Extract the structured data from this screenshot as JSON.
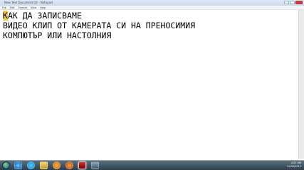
{
  "window": {
    "title": "New Text Document.txt - Notepad",
    "controls": [
      "minimize",
      "maximize",
      "close"
    ]
  },
  "menu": {
    "items": [
      "File",
      "Edit",
      "Format",
      "View",
      "Help"
    ]
  },
  "document": {
    "highlight_char": "К",
    "line1_rest": "АК ДА ЗАПИСВАМЕ",
    "line2": "ВИДЕО КЛИП ОТ КАМЕРАТА СИ НА ПРЕНОСИМИЯ",
    "line3": "КОМПЮТЪР ИЛИ НАСТОЛНИЯ"
  },
  "taskbar": {
    "icons": [
      "start-orb-icon",
      "internet-explorer-icon",
      "skype-icon",
      "windows-explorer-icon",
      "media-player-icon",
      "firefox-icon",
      "app-red-icon",
      "app-gray-icon"
    ]
  },
  "tray": {
    "time": "4:37 AM",
    "date": "11/26/2012"
  },
  "colors": {
    "highlight": "#f2c94c",
    "taskbar": "#2d3d4a"
  }
}
